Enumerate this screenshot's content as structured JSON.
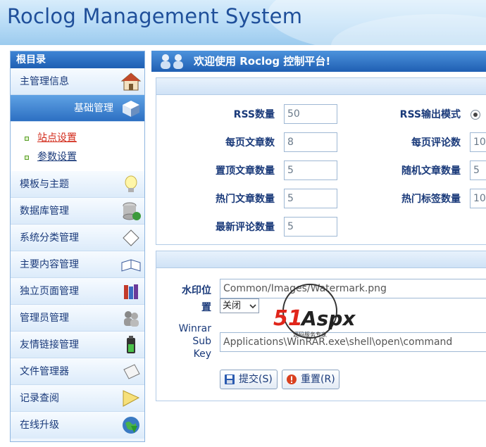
{
  "header": {
    "title": "Roclog Management System"
  },
  "sidebar": {
    "root_label": "根目录",
    "items_top": [
      {
        "label": "主管理信息",
        "icon": "house-icon"
      },
      {
        "label": "基础管理",
        "icon": "cube-icon",
        "active": true
      }
    ],
    "sub_items": [
      {
        "label": "站点设置",
        "current": true
      },
      {
        "label": "参数设置"
      }
    ],
    "items_bottom": [
      {
        "label": "模板与主题",
        "icon": "lightbulb-icon"
      },
      {
        "label": "数据库管理",
        "icon": "database-icon"
      },
      {
        "label": "系统分类管理",
        "icon": "tag-icon"
      },
      {
        "label": "主要内容管理",
        "icon": "open-book-icon"
      },
      {
        "label": "独立页面管理",
        "icon": "books-icon"
      },
      {
        "label": "管理员管理",
        "icon": "users-icon"
      },
      {
        "label": "友情链接管理",
        "icon": "battery-icon"
      },
      {
        "label": "文件管理器",
        "icon": "file-icon"
      },
      {
        "label": "记录查阅",
        "icon": "pencil-icon"
      },
      {
        "label": "在线升级",
        "icon": "globe-icon"
      }
    ]
  },
  "main": {
    "welcome": "欢迎使用 Roclog 控制平台!",
    "settings": {
      "rss_count_label": "RSS数量",
      "rss_count_value": "50",
      "rss_mode_label": "RSS输出模式",
      "per_page_posts_label": "每页文章数",
      "per_page_posts_value": "8",
      "per_page_comments_label": "每页评论数",
      "per_page_comments_value": "10",
      "sticky_posts_label": "置顶文章数量",
      "sticky_posts_value": "5",
      "random_posts_label": "随机文章数量",
      "random_posts_value": "5",
      "hot_posts_label": "热门文章数量",
      "hot_posts_value": "5",
      "hot_tags_label": "热门标签数量",
      "hot_tags_value": "10",
      "latest_comments_label": "最新评论数量",
      "latest_comments_value": "5"
    },
    "watermark": {
      "position_label_1": "水印位",
      "position_label_2": "置",
      "image_path": "Common/Images/Watermark.png",
      "select_value": "关闭",
      "winrar_label_1": "Winrar",
      "winrar_label_2": "Sub",
      "winrar_label_3": "Key",
      "winrar_value": "Applications\\WinRAR.exe\\shell\\open\\command"
    },
    "buttons": {
      "submit": "提交(S)",
      "reset": "重置(R)"
    },
    "overlay_logo": {
      "brand": "51Aspx",
      "tagline": "源码服务专家"
    }
  },
  "colors": {
    "accent": "#1f5fb3",
    "link_current": "#d22a1a"
  }
}
